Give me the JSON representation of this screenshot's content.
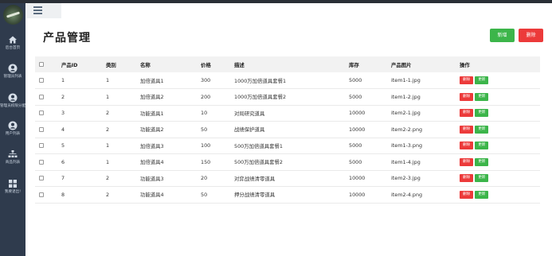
{
  "sidebar": {
    "items": [
      {
        "label": "后台首页",
        "icon": "home-icon"
      },
      {
        "label": "管理员列表",
        "icon": "user-icon"
      },
      {
        "label": "管理员权限分配",
        "icon": "user-icon"
      },
      {
        "label": "用户列表",
        "icon": "user-icon"
      },
      {
        "label": "商品列表",
        "icon": "sitemap-icon"
      },
      {
        "label": "我要退出!",
        "icon": "grid-icon"
      }
    ]
  },
  "header": {
    "menu_icon": "hamburger-icon"
  },
  "page": {
    "title": "产品管理",
    "add_label": "新增",
    "delete_label": "删除"
  },
  "colors": {
    "sidebar": "#2f3b4d",
    "add": "#3cb54a",
    "delete": "#ec3a3a",
    "header_row": "#f2f2f2"
  },
  "table": {
    "headers": [
      "产品ID",
      "类别",
      "名称",
      "价格",
      "描述",
      "库存",
      "产品图片",
      "操作"
    ],
    "row_delete_label": "删除",
    "row_update_label": "更新",
    "rows": [
      {
        "id": "1",
        "category": "1",
        "name": "加倍道具1",
        "price": "300",
        "desc": "1000万加倍道具套餐1",
        "stock": "5000",
        "image": "item1-1.jpg"
      },
      {
        "id": "2",
        "category": "1",
        "name": "加倍道具2",
        "price": "200",
        "desc": "1000万加倍道具套餐2",
        "stock": "5000",
        "image": "item1-2.jpg"
      },
      {
        "id": "3",
        "category": "2",
        "name": "功能道具1",
        "price": "10",
        "desc": "对局研究道具",
        "stock": "10000",
        "image": "item2-1.jpg"
      },
      {
        "id": "4",
        "category": "2",
        "name": "功能道具2",
        "price": "50",
        "desc": "战绩保护道具",
        "stock": "10000",
        "image": "item2-2.png"
      },
      {
        "id": "5",
        "category": "1",
        "name": "加倍道具3",
        "price": "100",
        "desc": "500万加倍道具套餐1",
        "stock": "5000",
        "image": "item1-3.png"
      },
      {
        "id": "6",
        "category": "1",
        "name": "加倍道具4",
        "price": "150",
        "desc": "500万加倍道具套餐2",
        "stock": "5000",
        "image": "item1-4.jpg"
      },
      {
        "id": "7",
        "category": "2",
        "name": "功能道具3",
        "price": "20",
        "desc": "对弈战绩清零道具",
        "stock": "10000",
        "image": "item2-3.jpg"
      },
      {
        "id": "8",
        "category": "2",
        "name": "功能道具4",
        "price": "50",
        "desc": "押分战绩清零道具",
        "stock": "10000",
        "image": "item2-4.png"
      }
    ]
  }
}
